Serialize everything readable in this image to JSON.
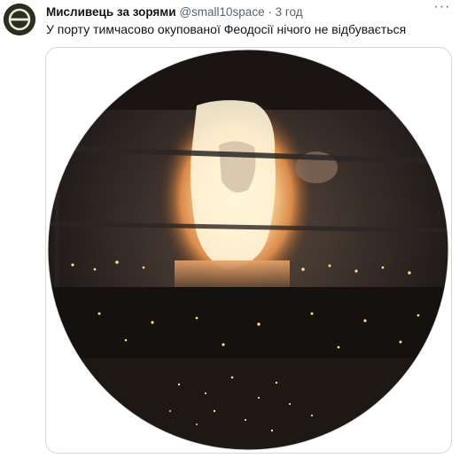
{
  "tweet": {
    "author_name": "Мисливець за зорями",
    "author_handle": "@small10space",
    "separator": "·",
    "time": "3 год",
    "text": "У порту тимчасово окупованої Феодосії нічого не відбувається",
    "more_icon": "more-horizontal-icon",
    "avatar_icon": "circle-logo-icon"
  },
  "colors": {
    "text_primary": "#0f1419",
    "text_secondary": "#536471",
    "border": "#cfd9de",
    "fire": "#ffb347"
  }
}
